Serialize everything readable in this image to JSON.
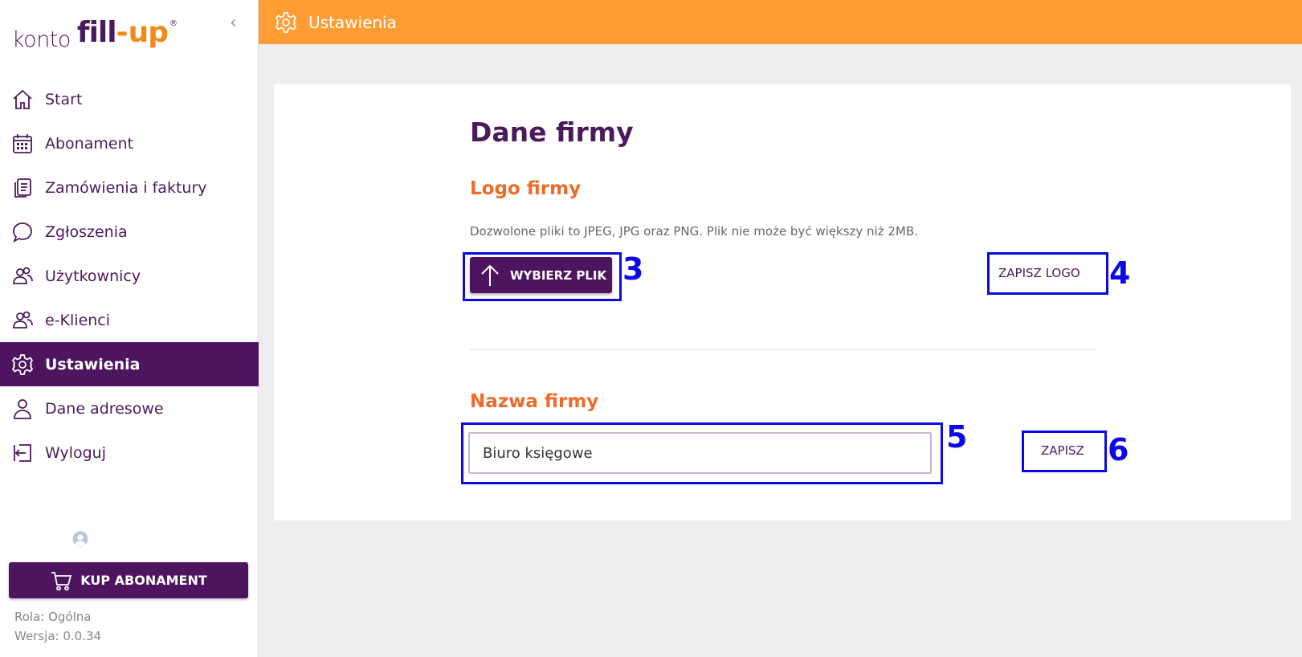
{
  "sidebar": {
    "logo": {
      "konto": "konto",
      "fill": "fill",
      "dash": "-",
      "up": "up",
      "reg": "®"
    },
    "collapse_glyph": "‹",
    "items": [
      {
        "label": "Start",
        "icon": "home-icon"
      },
      {
        "label": "Abonament",
        "icon": "calendar-icon"
      },
      {
        "label": "Zamówienia i faktury",
        "icon": "documents-icon"
      },
      {
        "label": "Zgłoszenia",
        "icon": "chat-bubble-icon"
      },
      {
        "label": "Użytkownicy",
        "icon": "users-icon"
      },
      {
        "label": "e-Klienci",
        "icon": "users-icon"
      },
      {
        "label": "Ustawienia",
        "icon": "gear-icon",
        "active": true
      },
      {
        "label": "Dane adresowe",
        "icon": "person-icon"
      },
      {
        "label": "Wyloguj",
        "icon": "logout-icon"
      }
    ],
    "buy_button": "KUP ABONAMENT",
    "role": "Rola: Ogólna",
    "version": "Wersja: 0.0.34"
  },
  "topbar": {
    "title": "Ustawienia",
    "icon": "gear-icon"
  },
  "main": {
    "title": "Dane firmy",
    "logo_section": {
      "heading": "Logo firmy",
      "hint": "Dozwolone pliki to JPEG, JPG oraz PNG. Plik nie może być większy niż 2MB.",
      "upload_button": "WYBIERZ PLIK",
      "save_button": "ZAPISZ LOGO"
    },
    "name_section": {
      "heading": "Nazwa firmy",
      "input_value": "Biuro księgowe",
      "save_button": "ZAPISZ"
    }
  },
  "annotations": [
    "3",
    "4",
    "5",
    "6"
  ],
  "colors": {
    "brand_purple": "#4e1460",
    "accent_orange": "#ff9c33",
    "heading_orange": "#ee6c2a",
    "annotation_blue": "#0a0ae6"
  }
}
